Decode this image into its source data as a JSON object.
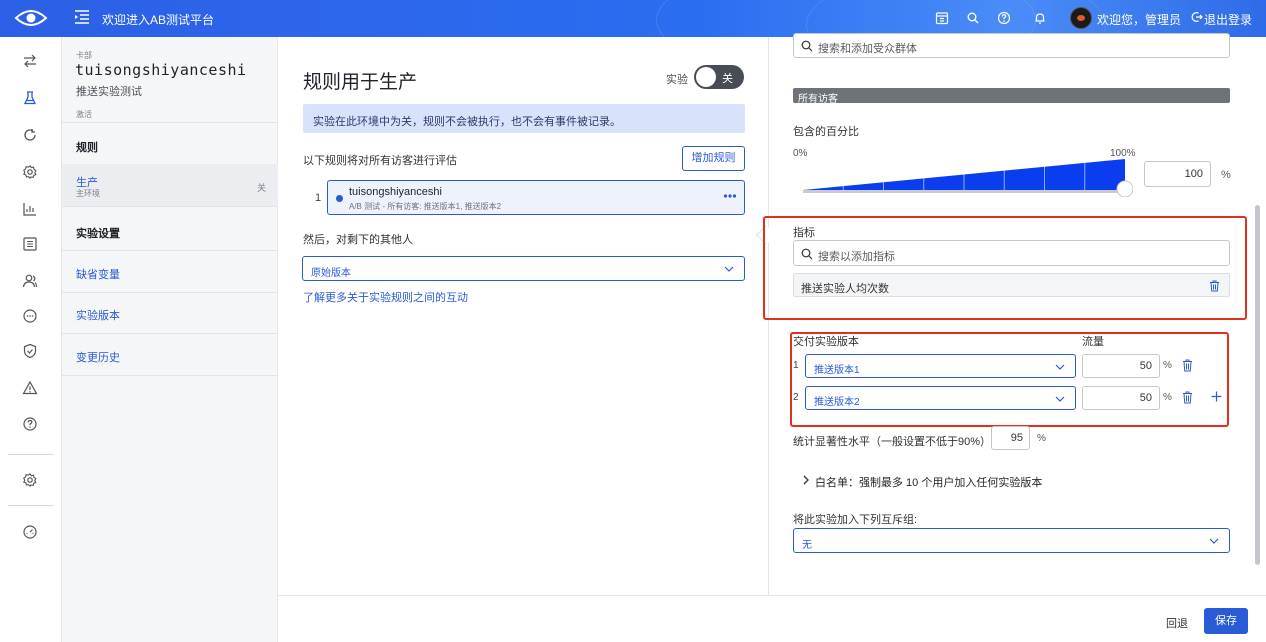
{
  "header": {
    "title": "欢迎进入AB测试平台",
    "welcome": "欢迎您，管理员",
    "logout": "退出登录",
    "icons": [
      "eye-logo-icon",
      "menu-icon",
      "calendar-icon",
      "search-icon",
      "help-icon",
      "bell-icon",
      "avatar",
      "logout-icon"
    ]
  },
  "rail": {
    "icons": [
      "switch-icon",
      "flask-icon",
      "refresh-icon",
      "gear-icon",
      "bar-chart-icon",
      "list-icon",
      "users-icon",
      "chat-icon",
      "shield-icon",
      "warning-icon",
      "help-icon",
      "settings-icon",
      "gauge-icon"
    ]
  },
  "nav": {
    "flag_label": "卡部",
    "flag_key": "tuisongshiyanceshi",
    "flag_name": "推送实验测试",
    "activate": "激活",
    "rules": "规则",
    "env_name": "生产",
    "env_sub": "主环境",
    "env_state": "关",
    "settings": "实验设置",
    "default_vars": "缺省变量",
    "versions": "实验版本",
    "history": "变更历史"
  },
  "middle": {
    "title": "规则用于生产",
    "toggle_label": "实验",
    "toggle_state": "关",
    "alert": "实验在此环境中为关，规则不会被执行，也不会有事件被记录。",
    "eval_text": "以下规则将对所有访客进行评估",
    "add_rule": "增加规则",
    "rule": {
      "index": "1",
      "name": "tuisongshiyanceshi",
      "desc": "A/B 测试 - 所有访客: 推送版本1, 推送版本2"
    },
    "then_text": "然后，对剩下的其他人",
    "fallback": "原始版本",
    "learn_more": "了解更多关于实验规则之间的互动"
  },
  "right": {
    "audience_placeholder": "搜索和添加受众群体",
    "audience_tag": "所有访客",
    "percent_label": "包含的百分比",
    "p0": "0%",
    "p100": "100%",
    "percent_value": "100",
    "percent_unit": "%",
    "percent_level": 100,
    "metric_title": "指标",
    "metric_placeholder": "搜索以添加指标",
    "metric_item": "推送实验人均次数",
    "deliver_label": "交付实验版本",
    "traffic_label": "流量",
    "variations": [
      {
        "index": "1",
        "name": "推送版本1",
        "traffic": "50",
        "unit": "%"
      },
      {
        "index": "2",
        "name": "推送版本2",
        "traffic": "50",
        "unit": "%"
      }
    ],
    "sig_label": "统计显著性水平（一般设置不低于90%）",
    "sig_value": "95",
    "sig_unit": "%",
    "whitelist": "白名单：强制最多 10 个用户加入任何实验版本",
    "mutex_label": "将此实验加入下列互斥组:",
    "mutex_value": "无"
  },
  "footer": {
    "cancel": "回退",
    "save": "保存"
  },
  "colors": {
    "primary": "#2a5bd7",
    "highlight": "#e2301f",
    "slider_fill": "#0a3df0"
  }
}
